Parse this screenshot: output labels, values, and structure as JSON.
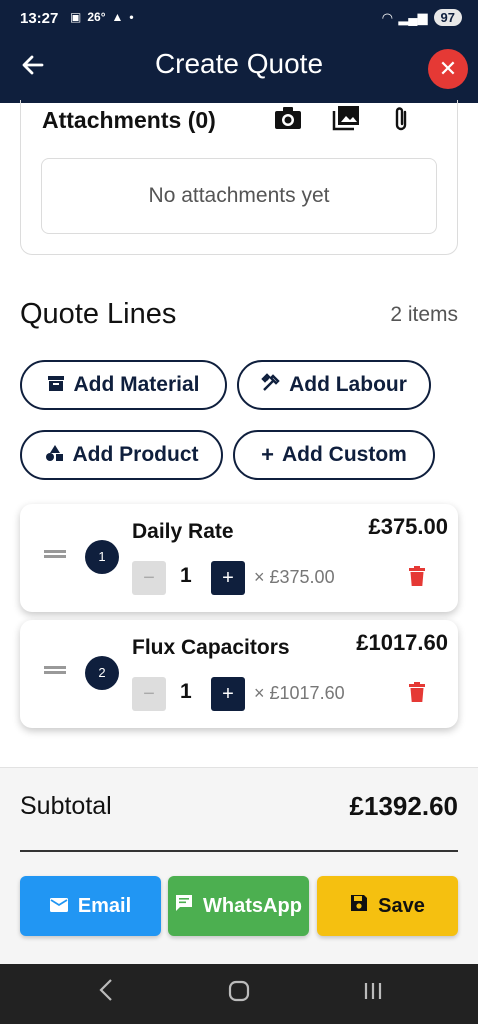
{
  "status_bar": {
    "time": "13:27",
    "temperature": "26°",
    "battery": "97"
  },
  "app_bar": {
    "title": "Create Quote"
  },
  "attachments": {
    "title": "Attachments (0)",
    "empty_text": "No attachments yet",
    "icons": [
      "camera-icon",
      "gallery-icon",
      "paperclip-icon"
    ]
  },
  "quote_lines": {
    "title": "Quote Lines",
    "count": "2 items",
    "buttons": {
      "material": "Add Material",
      "labour": "Add Labour",
      "product": "Add Product",
      "custom": "Add Custom"
    },
    "items": [
      {
        "index": "1",
        "name": "Daily Rate",
        "total": "£375.00",
        "qty": "1",
        "unit_price": "× £375.00"
      },
      {
        "index": "2",
        "name": "Flux Capacitors",
        "total": "£1017.60",
        "qty": "1",
        "unit_price": "× £1017.60"
      }
    ]
  },
  "summary": {
    "subtotal_label": "Subtotal",
    "subtotal_value": "£1392.60"
  },
  "actions": {
    "email": "Email",
    "whatsapp": "WhatsApp",
    "save": "Save"
  },
  "colors": {
    "primary": "#0f1f3d",
    "danger": "#e53935",
    "email": "#2196f3",
    "whatsapp": "#4caf50",
    "save": "#f5c010"
  }
}
